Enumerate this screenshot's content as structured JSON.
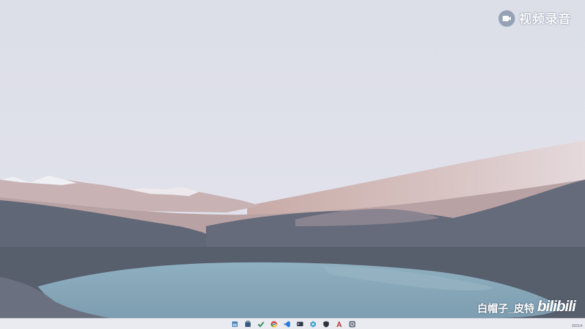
{
  "watermark_top": {
    "text": "视频录音"
  },
  "watermark_bottom": {
    "author": "白帽子_皮特",
    "site": "bilibili"
  },
  "taskbar": {
    "icons": [
      {
        "name": "file-explorer-icon",
        "color": "#4a7fb5"
      },
      {
        "name": "store-icon",
        "color": "#3b5a80"
      },
      {
        "name": "todo-check-icon",
        "color": "#2e8b57"
      },
      {
        "name": "chrome-icon",
        "color": "#d0453a"
      },
      {
        "name": "vscode-icon",
        "color": "#2b7bd6"
      },
      {
        "name": "terminal-icon",
        "color": "#2f3a4a"
      },
      {
        "name": "app-icon",
        "color": "#3fa0c8"
      },
      {
        "name": "shield-icon",
        "color": "#2d3440"
      },
      {
        "name": "pdf-icon",
        "color": "#b8302b"
      },
      {
        "name": "settings-icon",
        "color": "#6a7280"
      }
    ],
    "time": "2021/4"
  },
  "colors": {
    "sky": "#dfe1ea",
    "mountain_pink": "#c9b0ae",
    "hill_dark": "#5f6675",
    "lake": "#87a7b8",
    "taskbar": "#e9ebf1"
  }
}
